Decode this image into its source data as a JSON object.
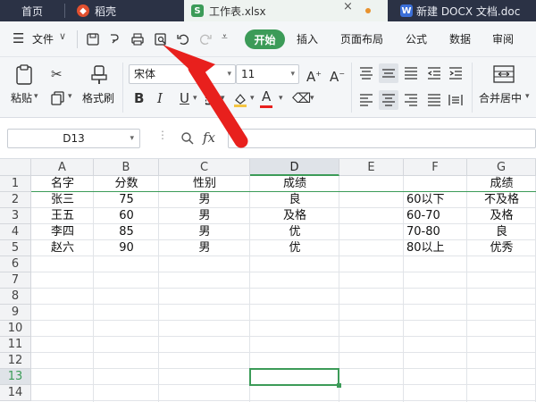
{
  "tabs": [
    {
      "label": "首页"
    },
    {
      "label": "稻壳"
    },
    {
      "label": "工作表.xlsx"
    },
    {
      "label": "新建 DOCX 文档.doc"
    }
  ],
  "menu": {
    "file": "文件",
    "items": [
      "开始",
      "插入",
      "页面布局",
      "公式",
      "数据",
      "审阅"
    ]
  },
  "ribbon": {
    "paste": "粘贴",
    "format_painter": "格式刷",
    "font_name": "宋体",
    "font_size": "11",
    "merge_center": "合并居中"
  },
  "formula_bar": {
    "name_box": "D13",
    "fx": "fx",
    "value": ""
  },
  "grid": {
    "columns": [
      "A",
      "B",
      "C",
      "D",
      "E",
      "F",
      "G"
    ],
    "rows": [
      "1",
      "2",
      "3",
      "4",
      "5",
      "6",
      "7",
      "8",
      "9",
      "10",
      "11",
      "12",
      "13",
      "14"
    ],
    "selected_cell": "D13",
    "cells": {
      "A1": "名字",
      "B1": "分数",
      "C1": "性别",
      "D1": "成绩",
      "G1": "成绩",
      "A2": "张三",
      "B2": "75",
      "C2": "男",
      "D2": "良",
      "F2": "60以下",
      "G2": "不及格",
      "A3": "王五",
      "B3": "60",
      "C3": "男",
      "D3": "及格",
      "F3": "60-70",
      "G3": "及格",
      "A4": "李四",
      "B4": "85",
      "C4": "男",
      "D4": "优",
      "F4": "70-80",
      "G4": "良",
      "A5": "赵六",
      "B5": "90",
      "C5": "男",
      "D5": "优",
      "F5": "80以上",
      "G5": "优秀"
    }
  },
  "colors": {
    "accent_green": "#3c9b58",
    "tabbar_bg": "#2b3245",
    "arrow_red": "#e8201d"
  }
}
